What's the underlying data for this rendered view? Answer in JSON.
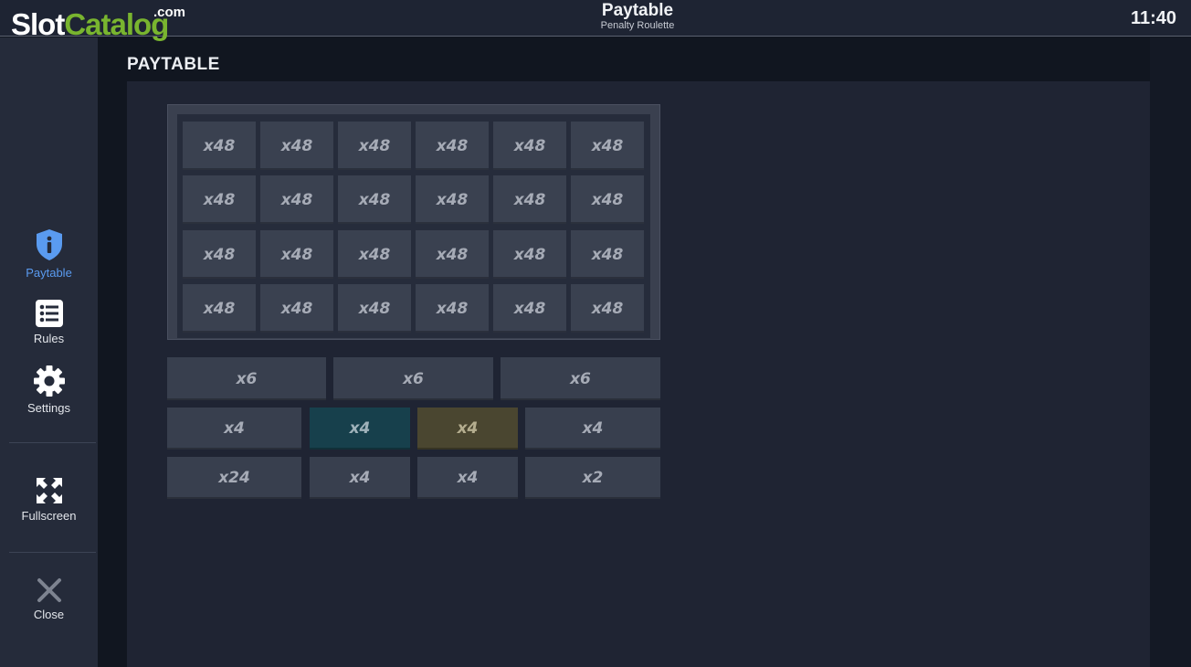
{
  "logo": {
    "part1": "Slot",
    "part2": "Catalog",
    "suffix": ".com"
  },
  "header": {
    "title": "Paytable",
    "subtitle": "Penalty Roulette",
    "clock": "11:40"
  },
  "sidebar": {
    "items": [
      {
        "label": "Paytable",
        "icon": "info-shield-icon",
        "active": true
      },
      {
        "label": "Rules",
        "icon": "list-icon"
      },
      {
        "label": "Settings",
        "icon": "gear-icon"
      },
      {
        "label": "Fullscreen",
        "icon": "fullscreen-icon"
      },
      {
        "label": "Close",
        "icon": "close-icon"
      }
    ]
  },
  "main": {
    "section_title": "PAYTABLE"
  },
  "paytable": {
    "grid_rows": [
      [
        "x48",
        "x48",
        "x48",
        "x48",
        "x48",
        "x48"
      ],
      [
        "x48",
        "x48",
        "x48",
        "x48",
        "x48",
        "x48"
      ],
      [
        "x48",
        "x48",
        "x48",
        "x48",
        "x48",
        "x48"
      ],
      [
        "x48",
        "x48",
        "x48",
        "x48",
        "x48",
        "x48"
      ]
    ],
    "row_thirds": [
      "x6",
      "x6",
      "x6"
    ],
    "row_mid": [
      {
        "label": "x4",
        "tone": "default"
      },
      {
        "label": "x4",
        "tone": "teal"
      },
      {
        "label": "x4",
        "tone": "olive"
      },
      {
        "label": "x4",
        "tone": "default"
      }
    ],
    "row_bottom": [
      "x24",
      "x4",
      "x4",
      "x2"
    ]
  },
  "colors": {
    "accent": "#5a9bf0",
    "logo_green": "#79b52f",
    "teal_cell": "#17404c",
    "olive_cell": "#4a4630"
  }
}
